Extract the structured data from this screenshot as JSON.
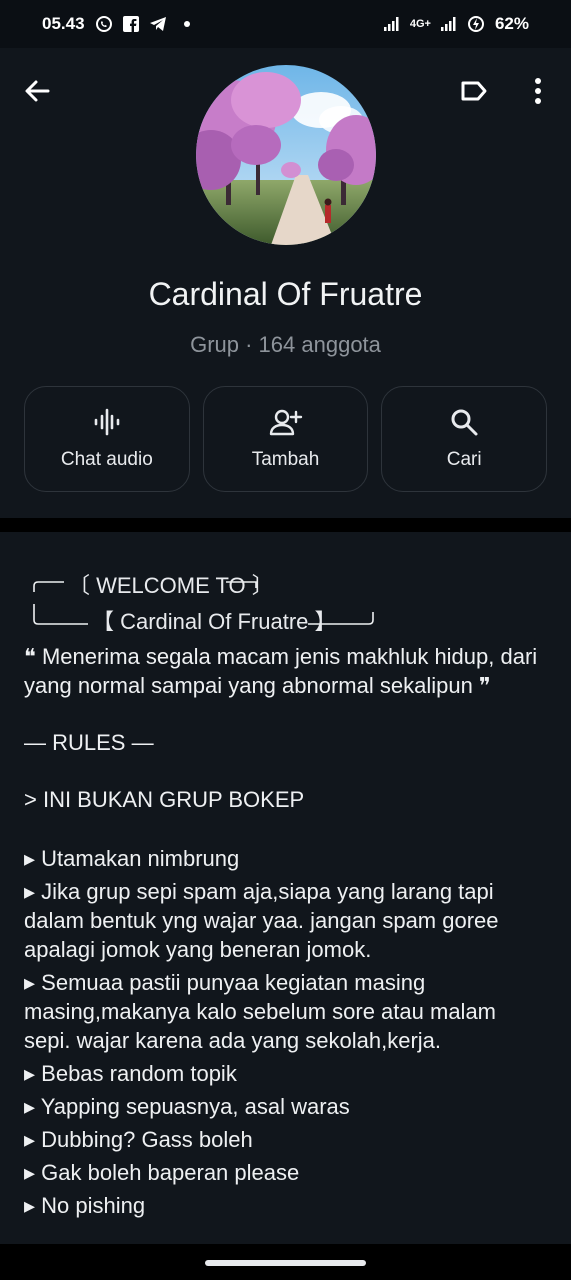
{
  "status_bar": {
    "time": "05.43",
    "network": "4G+",
    "battery": "62%"
  },
  "group": {
    "name": "Cardinal Of Fruatre",
    "subtitle": "Grup · 164 anggota"
  },
  "actions": [
    {
      "label": "Chat audio",
      "icon": "audio-waveform-icon"
    },
    {
      "label": "Tambah",
      "icon": "add-person-icon"
    },
    {
      "label": "Cari",
      "icon": "search-icon"
    }
  ],
  "description": {
    "welcome": "〔 WELCOME TO 〕",
    "cardinal": "【 Cardinal Of Fruatre 】",
    "intro": "❝ Menerima segala macam jenis makhluk hidup, dari yang normal sampai yang abnormal sekalipun ❞",
    "rules_heading": "— RULES —",
    "notice": "> INI BUKAN GRUP BOKEP",
    "rules": [
      "▸ Utamakan nimbrung",
      "▸ Jika grup sepi spam aja,siapa yang larang tapi dalam bentuk yng wajar yaa. jangan spam goree apalagi jomok yang beneran jomok.",
      "▸ Semuaa pastii punyaa kegiatan masing masing,makanya kalo sebelum sore atau malam sepi. wajar karena ada yang sekolah,kerja.",
      "▸ Bebas random topik",
      "▸ Yapping sepuasnya, asal waras",
      "▸ Dubbing? Gass boleh",
      "▸ Gak boleh baperan please",
      "▸ No pishing"
    ]
  }
}
